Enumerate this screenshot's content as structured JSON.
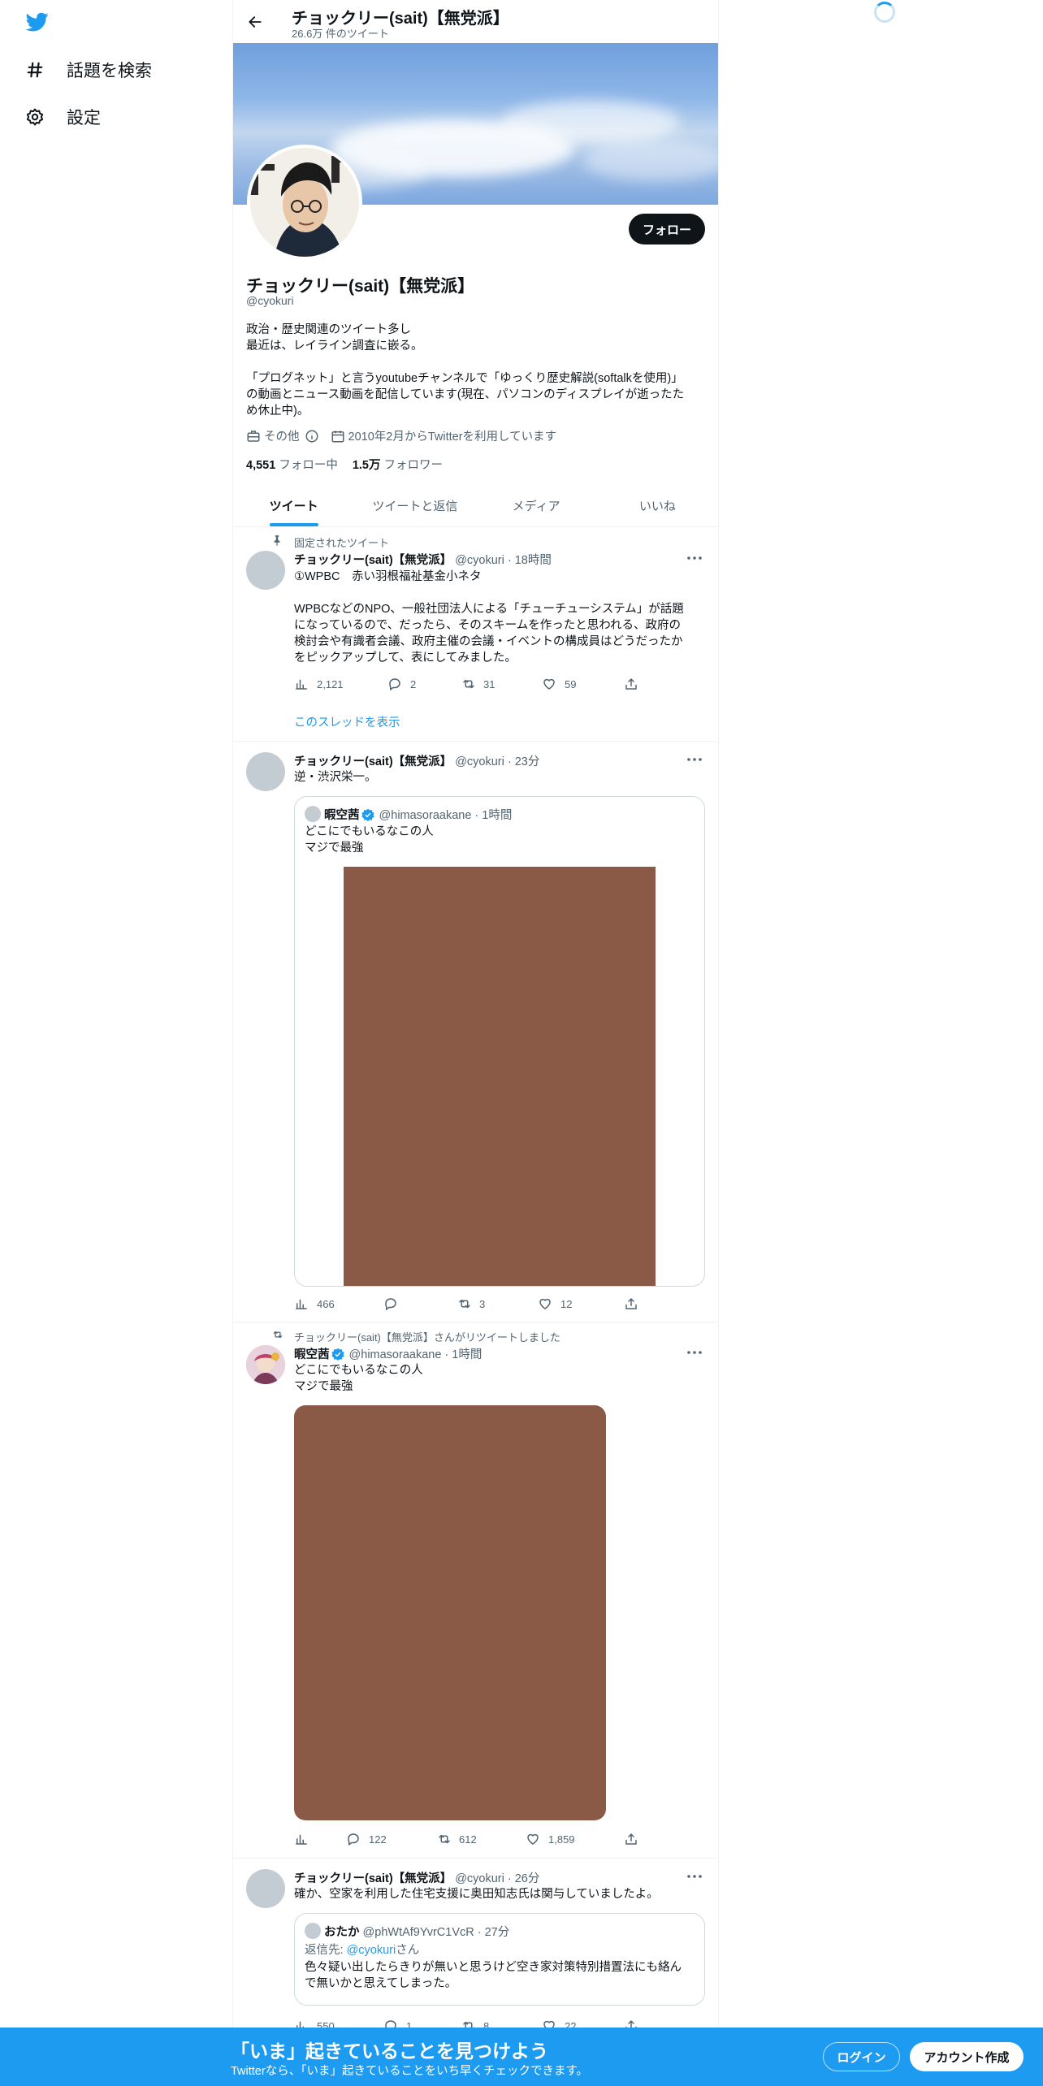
{
  "sidebar": {
    "logo": "twitter-bird-icon",
    "items": [
      {
        "label": "話題を検索",
        "icon": "hashtag-icon"
      },
      {
        "label": "設定",
        "icon": "gear-icon"
      }
    ]
  },
  "header": {
    "name": "チョックリー(sait)【無党派】",
    "tweet_count": "26.6万 件のツイート"
  },
  "profile": {
    "name": "チョックリー(sait)【無党派】",
    "handle": "@cyokuri",
    "follow_label": "フォロー",
    "bio": [
      "政治・歴史関連のツイート多し",
      "最近は、レイライン調査に嵌る。",
      "「プログネット」と言うyoutubeチャンネルで「ゆっくり歴史解説(softalkを使用)」",
      "の動画とニュース動画を配信しています(現在、パソコンのディスプレイが逝ったた",
      "め休止中)。"
    ],
    "category": "その他",
    "joined": "2010年2月からTwitterを利用しています",
    "following_count": "4,551",
    "following_label": "フォロー中",
    "followers_count": "1.5万",
    "followers_label": "フォロワー"
  },
  "tabs": [
    {
      "label": "ツイート",
      "active": true
    },
    {
      "label": "ツイートと返信",
      "active": false
    },
    {
      "label": "メディア",
      "active": false
    },
    {
      "label": "いいね",
      "active": false
    }
  ],
  "tweets": [
    {
      "context": "固定されたツイート",
      "name": "チョックリー(sait)【無党派】",
      "handle": "@cyokuri · 18時間",
      "lines": [
        "①WPBC　赤い羽根福祉基金小ネタ",
        "",
        "WPBCなどのNPO、一般社団法人による「チューチューシステム」が話題",
        "になっているので、だったら、そのスキームを作ったと思われる、政府の",
        "検討会や有識者会議、政府主催の会議・イベントの構成員はどうだったか",
        "をピックアップして、表にしてみました。"
      ],
      "views": "2,121",
      "replies": "2",
      "retweets": "31",
      "likes": "59",
      "show_thread": "このスレッドを表示"
    },
    {
      "name": "チョックリー(sait)【無党派】",
      "handle": "@cyokuri · 23分",
      "lines": [
        "逆・渋沢栄一。"
      ],
      "quote": {
        "name": "暇空茜",
        "handle": "@himasoraakane · 1時間",
        "lines": [
          "どこにでもいるなこの人",
          "マジで最強"
        ]
      },
      "views": "466",
      "replies": "",
      "retweets": "3",
      "likes": "12"
    },
    {
      "context": "チョックリー(sait)【無党派】さんがリツイートしました",
      "name": "暇空茜",
      "handle": "@himasoraakane · 1時間",
      "lines": [
        "どこにでもいるなこの人",
        "マジで最強"
      ],
      "views": "",
      "replies": "122",
      "retweets": "612",
      "likes": "1,859"
    },
    {
      "name": "チョックリー(sait)【無党派】",
      "handle": "@cyokuri · 26分",
      "lines": [
        "確か、空家を利用した住宅支援に奥田知志氏は関与していましたよ。"
      ],
      "quote": {
        "name": "おたか",
        "handle": "@phWtAf9YvrC1VcR · 27分",
        "reply_prefix": "返信先: ",
        "reply_to": "@cyokuri",
        "reply_suffix": "さん",
        "lines": [
          "色々疑い出したらきりが無いと思うけど空き家対策特別措置法にも絡ん",
          "で無いかと思えてしまった。"
        ]
      },
      "views": "550",
      "replies": "1",
      "retweets": "8",
      "likes": "22"
    }
  ],
  "bottom_bar": {
    "title": "「いま」起きていることを見つけよう",
    "subtitle": "Twitterなら、「いま」起きていることをいち早くチェックできます。",
    "login": "ログイン",
    "signup": "アカウント作成"
  },
  "colors": {
    "accent": "#1d9bf0",
    "text": "#0f1419",
    "muted": "#536471",
    "media_placeholder": "#8a5a47"
  }
}
